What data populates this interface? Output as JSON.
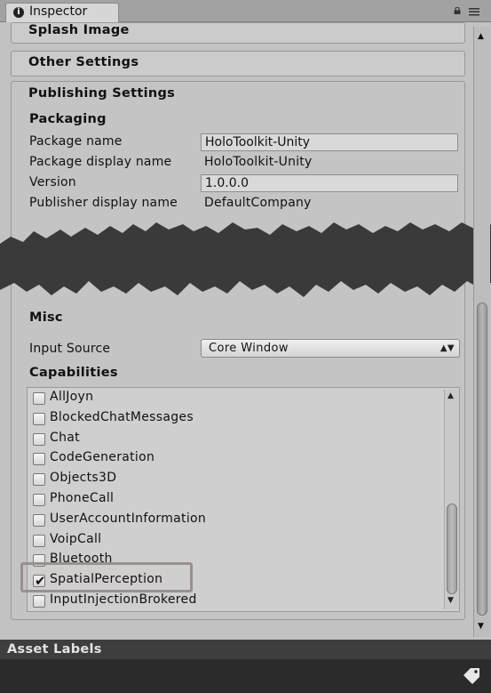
{
  "tab": {
    "title": "Inspector",
    "info_glyph": "i"
  },
  "sections": {
    "splash": "Splash Image",
    "other": "Other Settings",
    "publishing": "Publishing Settings"
  },
  "packaging": {
    "heading": "Packaging",
    "package_name_label": "Package name",
    "package_name_value": "HoloToolkit-Unity",
    "display_name_label": "Package display name",
    "display_name_value": "HoloToolkit-Unity",
    "version_label": "Version",
    "version_value": "1.0.0.0",
    "publisher_label": "Publisher display name",
    "publisher_value": "DefaultCompany"
  },
  "misc": {
    "heading": "Misc",
    "input_source_label": "Input Source",
    "input_source_value": "Core Window"
  },
  "capabilities": {
    "heading": "Capabilities",
    "items": [
      {
        "label": "AllJoyn",
        "checked": false
      },
      {
        "label": "BlockedChatMessages",
        "checked": false
      },
      {
        "label": "Chat",
        "checked": false
      },
      {
        "label": "CodeGeneration",
        "checked": false
      },
      {
        "label": "Objects3D",
        "checked": false
      },
      {
        "label": "PhoneCall",
        "checked": false
      },
      {
        "label": "UserAccountInformation",
        "checked": false
      },
      {
        "label": "VoipCall",
        "checked": false
      },
      {
        "label": "Bluetooth",
        "checked": false
      },
      {
        "label": "SpatialPerception",
        "checked": true
      },
      {
        "label": "InputInjectionBrokered",
        "checked": false
      }
    ]
  },
  "asset_labels": {
    "title": "Asset Labels"
  },
  "icons": {
    "info": "info-icon",
    "lock": "lock-icon",
    "menu": "menu-icon",
    "dropdown": "dropdown-arrows-icon",
    "tag": "tag-icon"
  },
  "colors": {
    "panel": "#c2c2c2",
    "asset_header": "#3e3e3e",
    "highlight": "#9b8f8f"
  }
}
